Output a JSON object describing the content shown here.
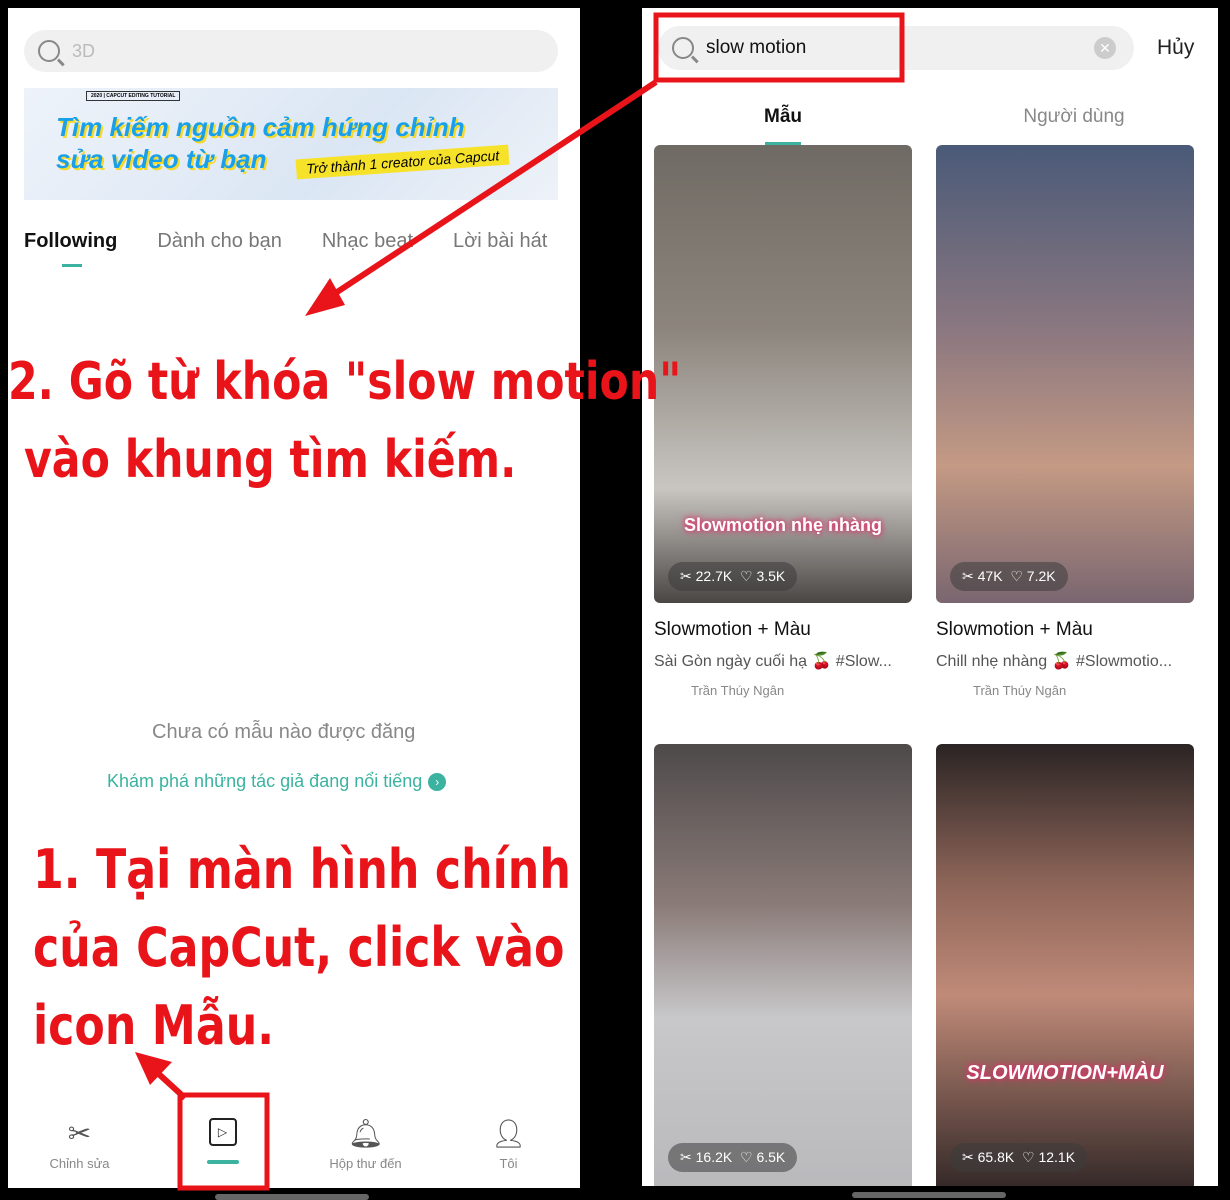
{
  "left": {
    "search_placeholder": "3D",
    "banner": {
      "tag": "2020 | CAPCUT EDITING TUTORIAL",
      "line1": "Tìm kiếm nguồn cảm hứng chỉnh",
      "line2": "sửa video từ bạn",
      "badge": "Trở thành 1 creator của Capcut"
    },
    "tabs": [
      "Following",
      "Dành cho bạn",
      "Nhạc beat",
      "Lời bài hát"
    ],
    "empty_text": "Chưa có mẫu nào được đăng",
    "explore_link": "Khám phá những tác giả đang nổi tiếng",
    "nav": [
      {
        "label": "Chỉnh sửa",
        "icon": "scissors-icon"
      },
      {
        "label": "",
        "icon": "template-icon"
      },
      {
        "label": "Hộp thư đến",
        "icon": "bell-icon"
      },
      {
        "label": "Tôi",
        "icon": "user-icon"
      }
    ]
  },
  "right": {
    "search_value": "slow motion",
    "cancel": "Hủy",
    "tabs": [
      "Mẫu",
      "Người dùng"
    ],
    "cards": [
      {
        "title": "Slowmotion + Màu",
        "desc": "Sài Gòn ngày cuối hạ 🍒 #Slow...",
        "author": "Trần Thúy Ngân",
        "uses": "22.7K",
        "likes": "3.5K",
        "overlay": "Slowmotion nhẹ nhàng"
      },
      {
        "title": "Slowmotion + Màu",
        "desc": "Chill nhẹ nhàng 🍒 #Slowmotio...",
        "author": "Trần Thúy Ngân",
        "uses": "47K",
        "likes": "7.2K",
        "overlay": ""
      },
      {
        "uses": "16.2K",
        "likes": "6.5K",
        "overlay": ""
      },
      {
        "uses": "65.8K",
        "likes": "12.1K",
        "overlay": "SLOWMOTION+MÀU"
      }
    ]
  },
  "annotations": {
    "step2_line1": "2. Gõ từ khóa \"slow motion\"",
    "step2_line2": "vào khung tìm kiếm.",
    "step1_line1": "1. Tại màn hình chính",
    "step1_line2": "của CapCut, click vào",
    "step1_line3": "icon Mẫu."
  },
  "colors": {
    "accent": "#3bb3a0",
    "annotation": "#e8141a"
  }
}
